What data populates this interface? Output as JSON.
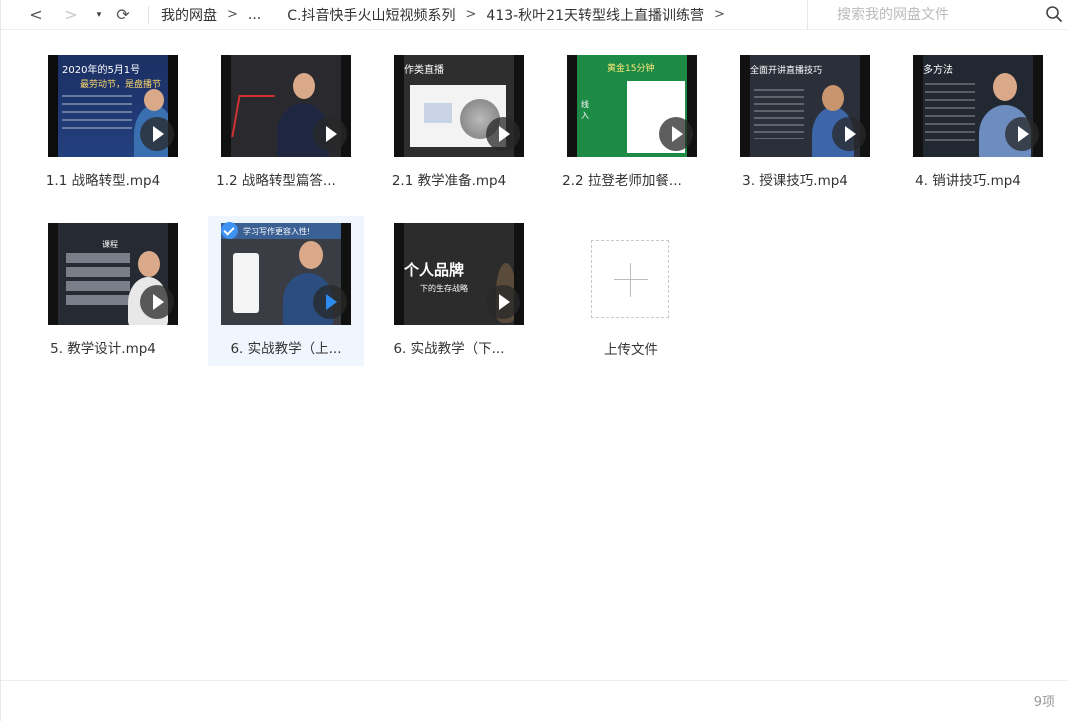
{
  "nav": {
    "back": "<",
    "forward": ">",
    "dropdown": "▾",
    "refresh": "⟳"
  },
  "breadcrumb": {
    "items": [
      "我的网盘",
      "...",
      "C.抖音快手火山短视频系列",
      "413-秋叶21天转型线上直播训练营"
    ],
    "separator": ">"
  },
  "search": {
    "placeholder": "搜索我的网盘文件",
    "icon": "search-icon"
  },
  "files": [
    {
      "label": "1.1 战略转型.mp4",
      "selected": false
    },
    {
      "label": "1.2 战略转型篇答...",
      "selected": false
    },
    {
      "label": "2.1 教学准备.mp4",
      "selected": false
    },
    {
      "label": "2.2 拉登老师加餐...",
      "selected": false
    },
    {
      "label": "3. 授课技巧.mp4",
      "selected": false
    },
    {
      "label": "4. 销讲技巧.mp4",
      "selected": false
    },
    {
      "label": "5. 教学设计.mp4",
      "selected": false
    },
    {
      "label": "6. 实战教学（上...",
      "selected": true
    },
    {
      "label": "6. 实战教学（下...",
      "selected": false
    }
  ],
  "thumb_text": {
    "t1_line1": "2020年的5月1号",
    "t1_line2": "最劳动节，是盘播节",
    "t3_title": "作类直播",
    "t4_title": "黄金15分钟",
    "t4_side": "线\n入",
    "t5_title": "全面开讲直播技巧",
    "t6_title": "多方法",
    "t7_title": "课程",
    "t8_banner": "学习写作更容入性!",
    "t9_big": "个人品牌",
    "t9_small": "下的生存战略"
  },
  "upload": {
    "label": "上传文件"
  },
  "status": {
    "count": "9项"
  },
  "colors": {
    "accent": "#3e93f2",
    "selected_bg": "#f0f6fd"
  }
}
